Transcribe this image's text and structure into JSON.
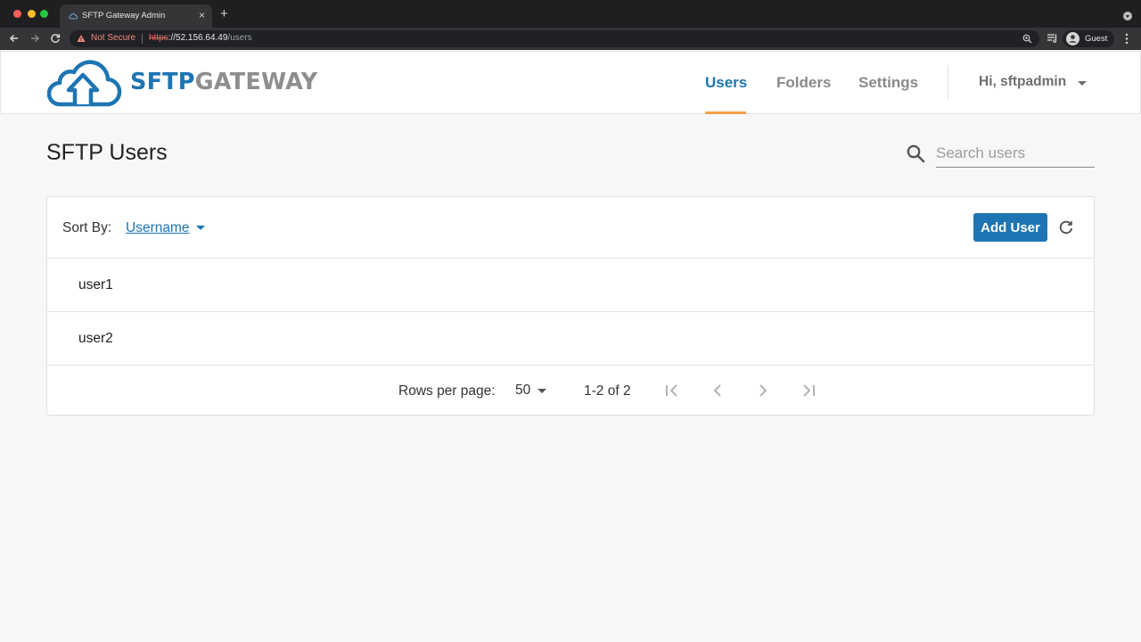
{
  "browser": {
    "tab_title": "SFTP Gateway Admin",
    "tab_close": "×",
    "new_tab": "+",
    "security_label": "Not Secure",
    "url_scheme": "https",
    "url_host": "://52.156.64.49",
    "url_path": "/users",
    "profile_name": "Guest"
  },
  "app": {
    "logo_primary": "SFTP",
    "logo_secondary": "GATEWAY",
    "brand_color": "#1d75b3",
    "accent_color": "#f5a04a",
    "nav": [
      {
        "label": "Users",
        "active": true
      },
      {
        "label": "Folders",
        "active": false
      },
      {
        "label": "Settings",
        "active": false
      }
    ],
    "user_greeting": "Hi, sftpadmin"
  },
  "page": {
    "title": "SFTP Users",
    "search_placeholder": "Search users"
  },
  "table": {
    "sort_label": "Sort By:",
    "sort_value": "Username",
    "add_button": "Add User",
    "rows": [
      "user1",
      "user2"
    ],
    "rows_per_page_label": "Rows per page:",
    "rows_per_page": "50",
    "range": "1-2 of 2"
  }
}
